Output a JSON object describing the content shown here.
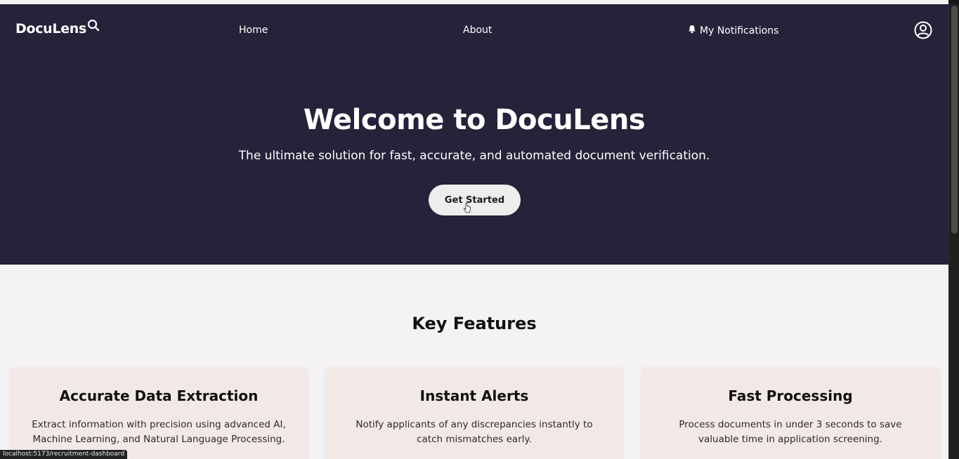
{
  "brand": {
    "name": "DocuLens",
    "icon": "search-icon"
  },
  "nav": {
    "home": "Home",
    "about": "About",
    "notifications": "My Notifications",
    "notifications_icon": "bell-icon",
    "account_icon": "user-circle-icon"
  },
  "hero": {
    "title": "Welcome to DocuLens",
    "subtitle": "The ultimate solution for fast, accurate, and automated document verification.",
    "cta": "Get Started"
  },
  "features": {
    "title": "Key Features",
    "cards": [
      {
        "title": "Accurate Data Extraction",
        "text": "Extract information with precision using advanced AI, Machine Learning, and Natural Language Processing."
      },
      {
        "title": "Instant Alerts",
        "text": "Notify applicants of any discrepancies instantly to catch mismatches early."
      },
      {
        "title": "Fast Processing",
        "text": "Process documents in under 3 seconds to save valuable time in application screening."
      }
    ]
  },
  "status_url": "localhost:5173/recruitment-dashboard",
  "colors": {
    "hero_bg": "#25233a",
    "page_bg": "#f4f2f3",
    "card_bg": "#f2e9e6",
    "button_bg": "#ededed"
  }
}
